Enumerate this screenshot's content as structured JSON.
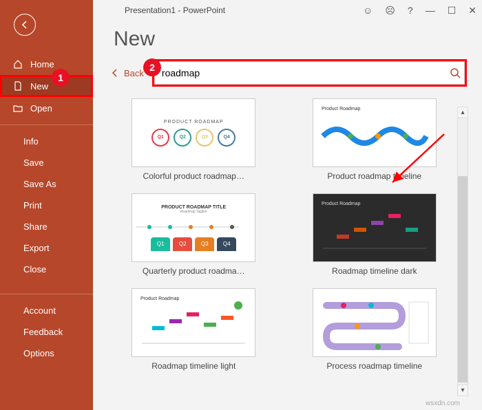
{
  "title": "Presentation1 - PowerPoint",
  "pageHeading": "New",
  "sidebar": {
    "home": "Home",
    "new": "New",
    "open": "Open",
    "info": "Info",
    "save": "Save",
    "saveAs": "Save As",
    "print": "Print",
    "share": "Share",
    "export": "Export",
    "close": "Close",
    "account": "Account",
    "feedback": "Feedback",
    "options": "Options"
  },
  "search": {
    "backLabel": "Back",
    "value": "roadmap"
  },
  "callouts": {
    "one": "1",
    "two": "2"
  },
  "templates": [
    {
      "label": "Colorful product roadmap…",
      "thumbTitle": "PRODUCT ROADMAP"
    },
    {
      "label": "Product roadmap timeline",
      "thumbTitle": "Product Roadmap"
    },
    {
      "label": "Quarterly product roadma…",
      "thumbTitle": "PRODUCT ROADMAP TITLE"
    },
    {
      "label": "Roadmap timeline dark",
      "thumbTitle": "Product Roadmap"
    },
    {
      "label": "Roadmap timeline light",
      "thumbTitle": "Product Roadmap"
    },
    {
      "label": "Process roadmap timeline",
      "thumbTitle": ""
    }
  ],
  "watermark": "wsxdn.com"
}
